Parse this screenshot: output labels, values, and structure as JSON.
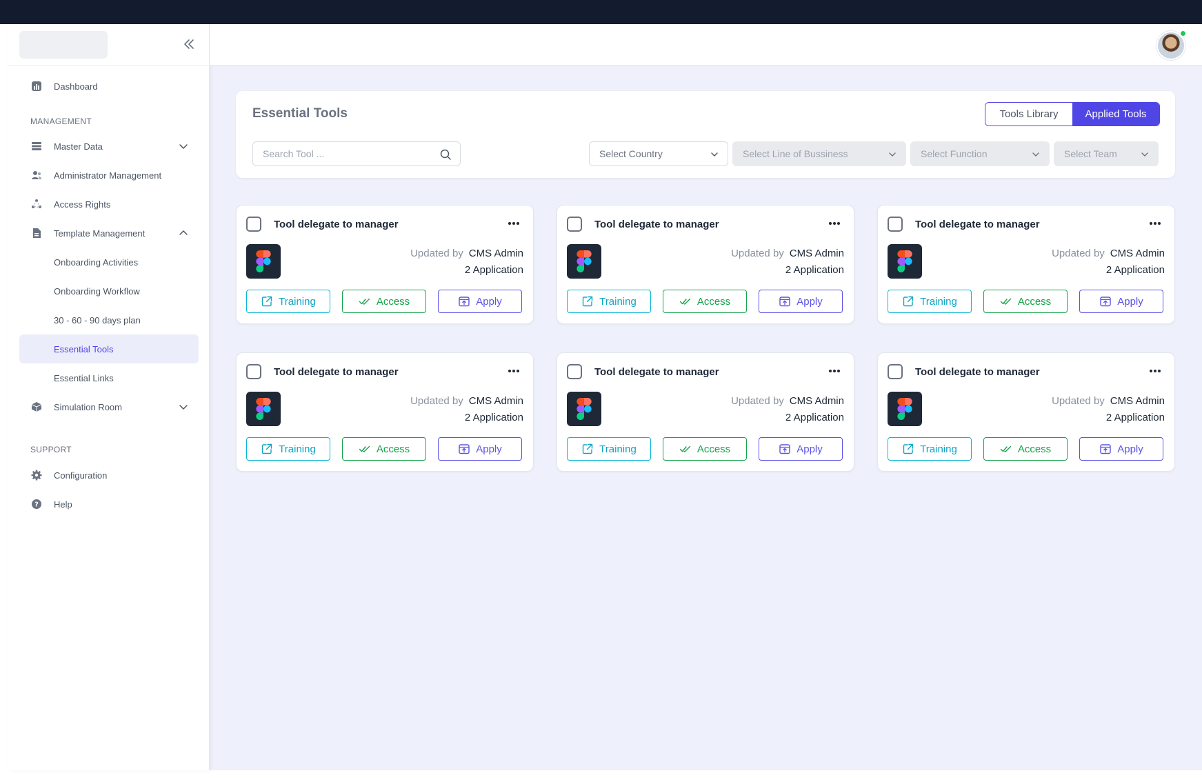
{
  "sidebar": {
    "items": [
      {
        "label": "Dashboard"
      },
      {
        "label": "Master Data"
      },
      {
        "label": "Administrator Management"
      },
      {
        "label": "Access Rights"
      },
      {
        "label": "Template Management"
      },
      {
        "label": "Simulation Room"
      },
      {
        "label": "Configuration"
      },
      {
        "label": "Help"
      }
    ],
    "sub_items": [
      {
        "label": "Onboarding Activities"
      },
      {
        "label": "Onboarding Workflow"
      },
      {
        "label": "30 - 60 - 90 days plan"
      },
      {
        "label": "Essential Tools",
        "active": true
      },
      {
        "label": "Essential Links"
      }
    ],
    "headings": {
      "management": "MANAGEMENT",
      "support": "SUPPORT"
    }
  },
  "main": {
    "title": "Essential Tools",
    "tabs": [
      {
        "label": "Tools Library",
        "active": false
      },
      {
        "label": "Applied Tools",
        "active": true
      }
    ],
    "search": {
      "placeholder": "Search Tool ..."
    },
    "filters": [
      {
        "label": "Select Country",
        "enabled": true
      },
      {
        "label": "Select Line of Bussiness",
        "enabled": false
      },
      {
        "label": "Select Function",
        "enabled": false
      },
      {
        "label": "Select Team",
        "enabled": false
      }
    ]
  },
  "cards": [
    {
      "title": "Tool delegate to manager",
      "updated_label": "Updated by",
      "updated_by": "CMS Admin",
      "applications": "2 Application",
      "training": "Training",
      "access": "Access",
      "apply": "Apply"
    },
    {
      "title": "Tool delegate to manager",
      "updated_label": "Updated by",
      "updated_by": "CMS Admin",
      "applications": "2 Application",
      "training": "Training",
      "access": "Access",
      "apply": "Apply"
    },
    {
      "title": "Tool delegate to manager",
      "updated_label": "Updated by",
      "updated_by": "CMS Admin",
      "applications": "2 Application",
      "training": "Training",
      "access": "Access",
      "apply": "Apply"
    },
    {
      "title": "Tool delegate to manager",
      "updated_label": "Updated by",
      "updated_by": "CMS Admin",
      "applications": "2 Application",
      "training": "Training",
      "access": "Access",
      "apply": "Apply"
    },
    {
      "title": "Tool delegate to manager",
      "updated_label": "Updated by",
      "updated_by": "CMS Admin",
      "applications": "2 Application",
      "training": "Training",
      "access": "Access",
      "apply": "Apply"
    },
    {
      "title": "Tool delegate to manager",
      "updated_label": "Updated by",
      "updated_by": "CMS Admin",
      "applications": "2 Application",
      "training": "Training",
      "access": "Access",
      "apply": "Apply"
    }
  ],
  "colors": {
    "accent": "#5046e5",
    "training": "#06b6d4",
    "access": "#16a34a",
    "apply": "#5b52e6",
    "topbar": "#131b2e",
    "content_bg": "#eef1fb",
    "status_online": "#22c55e"
  },
  "icons": {
    "tool_logo": "figma-logo-icon",
    "training": "external-link-icon",
    "access": "double-check-icon",
    "apply": "upload-icon"
  }
}
